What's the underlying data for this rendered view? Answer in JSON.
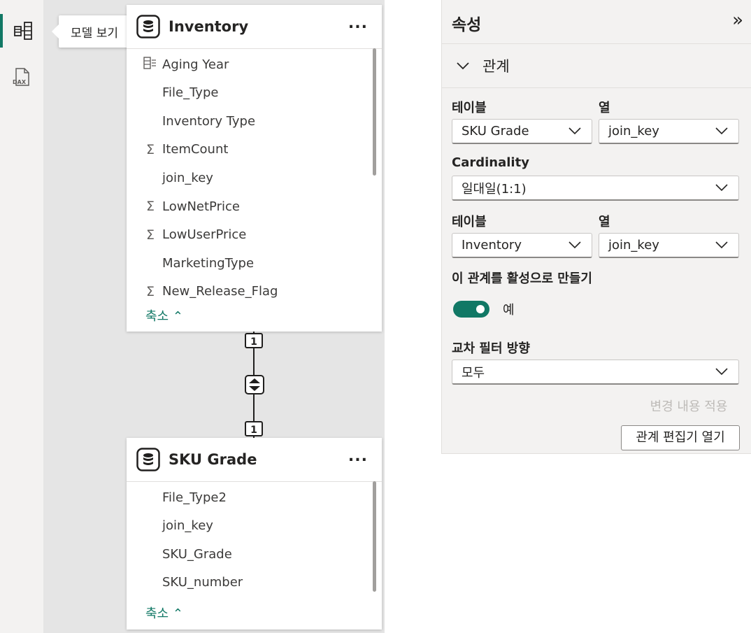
{
  "tooltip": {
    "model_view": "모델 보기"
  },
  "rail": [
    {
      "icon": "model-view-icon",
      "active": true
    },
    {
      "icon": "dax-query-view-icon",
      "active": false
    }
  ],
  "inventory_table": {
    "title": "Inventory",
    "more": "...",
    "fields": [
      {
        "icon": "hierarchy-icon",
        "name": "Aging Year"
      },
      {
        "icon": "",
        "name": "File_Type"
      },
      {
        "icon": "",
        "name": "Inventory Type"
      },
      {
        "icon": "sigma-icon",
        "name": "ItemCount"
      },
      {
        "icon": "",
        "name": "join_key"
      },
      {
        "icon": "sigma-icon",
        "name": "LowNetPrice"
      },
      {
        "icon": "sigma-icon",
        "name": "LowUserPrice"
      },
      {
        "icon": "",
        "name": "MarketingType"
      },
      {
        "icon": "sigma-icon",
        "name": "New_Release_Flag"
      }
    ],
    "collapse": "축소"
  },
  "sku_table": {
    "title": "SKU Grade",
    "more": "...",
    "fields": [
      {
        "icon": "",
        "name": "File_Type2"
      },
      {
        "icon": "",
        "name": "join_key"
      },
      {
        "icon": "",
        "name": "SKU_Grade"
      },
      {
        "icon": "",
        "name": "SKU_number"
      }
    ],
    "collapse": "축소"
  },
  "relationship": {
    "from_cardinality": "1",
    "to_cardinality": "1"
  },
  "properties": {
    "title": "속성",
    "section": "관계",
    "table_label": "테이블",
    "column_label": "열",
    "table1": "SKU Grade",
    "column1": "join_key",
    "cardinality_label": "Cardinality",
    "cardinality": "일대일(1:1)",
    "table2": "Inventory",
    "column2": "join_key",
    "active_label": "이 관계를 활성으로 만들기",
    "active_value": "예",
    "active_on": true,
    "filter_label": "교차 필터 방향",
    "filter_value": "모두",
    "apply_button": "변경 내용 적용",
    "editor_button": "관계 편집기 열기"
  },
  "colors": {
    "accent": "#117865",
    "canvas": "#e5e5e5",
    "panel": "#f3f2f1"
  }
}
